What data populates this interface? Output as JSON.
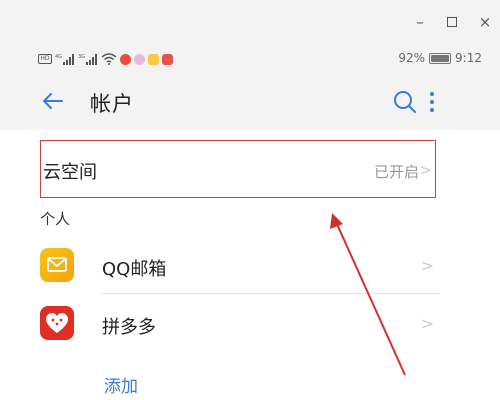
{
  "window": {
    "minimize_glyph": "–",
    "close_glyph": "×",
    "controls": [
      "minimize-icon",
      "maximize-icon",
      "close-icon"
    ]
  },
  "status_bar": {
    "battery_percent_label": "92%",
    "battery_level": 0.92,
    "time": "9:12",
    "hd_label": "HD",
    "icons": [
      "hd-icon",
      "signal-4g-icon",
      "signal-3g-icon",
      "wifi-icon",
      "app-notification-icon",
      "app-notification-icon",
      "app-notification-icon",
      "app-notification-icon"
    ]
  },
  "header": {
    "title": "帐户",
    "back_icon": "arrow-left-icon",
    "search_icon": "search-icon",
    "more_icon": "more-vertical-icon"
  },
  "cloud": {
    "label": "云空间",
    "status": "已开启",
    "chevron": ">"
  },
  "section": {
    "title": "个人"
  },
  "accounts": [
    {
      "name": "QQ邮箱",
      "icon": "mail-icon",
      "chevron": ">"
    },
    {
      "name": "拼多多",
      "icon": "pinduoduo-icon",
      "chevron": ">"
    }
  ],
  "add_label": "添加",
  "colors": {
    "accent": "#3a7bd5",
    "highlight_border": "#c94040",
    "annotation_arrow": "#d03030",
    "qq_mail_icon": "#f3a30c",
    "pinduoduo_icon": "#e02e24"
  }
}
